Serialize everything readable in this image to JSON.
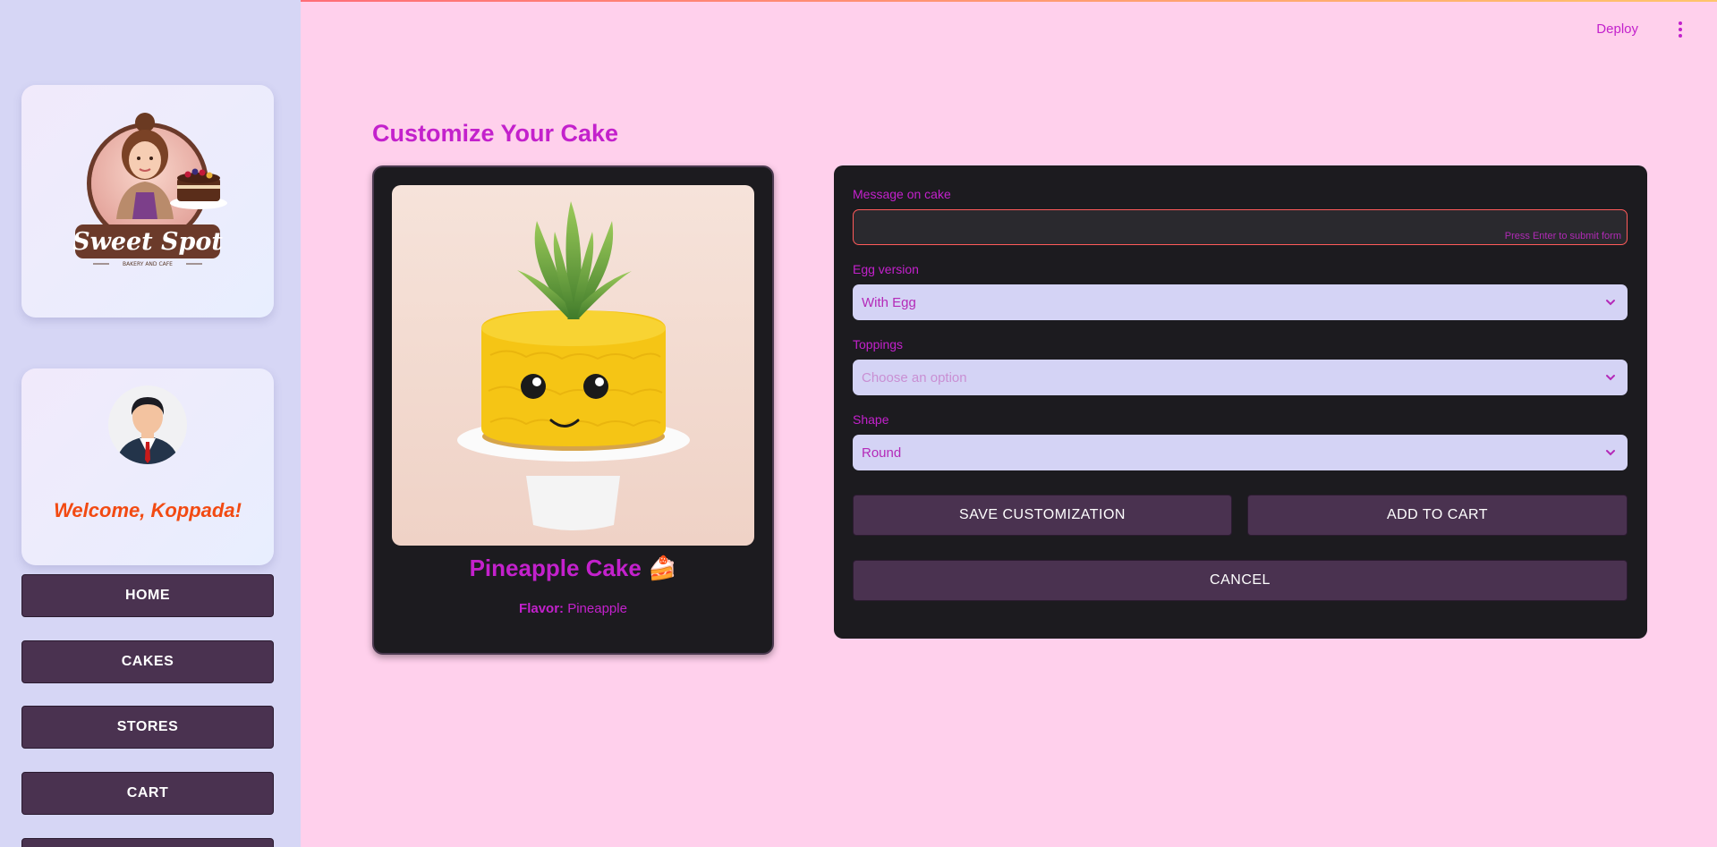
{
  "header": {
    "deploy_label": "Deploy",
    "menu_icon": "vertical-ellipsis-icon"
  },
  "sidebar": {
    "logo": {
      "name": "Sweet Spot",
      "tagline": "BAKERY AND CAFE"
    },
    "profile": {
      "welcome": "Welcome, Koppada!"
    },
    "nav": [
      {
        "label": "HOME"
      },
      {
        "label": "CAKES"
      },
      {
        "label": "STORES"
      },
      {
        "label": "CART"
      }
    ]
  },
  "main": {
    "title": "Customize Your Cake",
    "product": {
      "name": "Pineapple Cake 🍰",
      "flavor_label": "Flavor:",
      "flavor_value": "Pineapple"
    },
    "form": {
      "message": {
        "label": "Message on cake",
        "value": "",
        "hint": "Press Enter to submit form"
      },
      "egg": {
        "label": "Egg version",
        "value": "With Egg"
      },
      "toppings": {
        "label": "Toppings",
        "placeholder": "Choose an option"
      },
      "shape": {
        "label": "Shape",
        "value": "Round"
      },
      "save_label": "SAVE CUSTOMIZATION",
      "add_label": "ADD TO CART",
      "cancel_label": "CANCEL"
    }
  },
  "colors": {
    "accent": "#c321cc",
    "welcome": "#f24a12",
    "button": "#4a3250",
    "panel": "#1c1b1f",
    "background": "#ffd0ec",
    "sidebar": "#d6d6f5"
  }
}
